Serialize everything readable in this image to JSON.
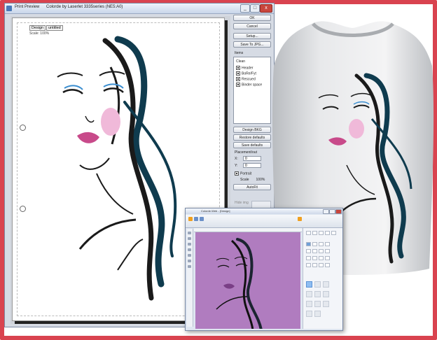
{
  "window": {
    "title": "Print Preview",
    "doc_title": "Colorde by Laserlet 3335series (NE5:A0)",
    "controls": {
      "minimize": "_",
      "maximize": "□",
      "close": "x"
    }
  },
  "paper": {
    "chips": [
      "Design",
      "untitled"
    ],
    "scale_text": "Scale: 100%"
  },
  "panel": {
    "ok": "OK",
    "cancel": "Cancel",
    "setup": "Setup...",
    "save_jpg": "Save To JPG...",
    "items_label": "Items",
    "items": [
      {
        "label": "Clean",
        "checked": null
      },
      {
        "label": "Header",
        "checked": true
      },
      {
        "label": "BoRe/Fyt",
        "checked": true
      },
      {
        "label": "Rescued",
        "checked": true
      },
      {
        "label": "Binder space",
        "checked": true
      }
    ],
    "design_bkg": "Design BKG",
    "restore_defaults": "Restore defaults",
    "save_defaults": "Save defaults",
    "placement_label": "Placement/out",
    "x_label": "X:",
    "x_value": "0",
    "y_label": "Y:",
    "y_value": "0",
    "portrait": "Portrait",
    "scale_label": "Scale",
    "scale_value": "100%",
    "autofit": "AutoFit",
    "bottom_label": "Hide img"
  },
  "editor": {
    "title": "Colorde.Web - [Design]"
  },
  "colors": {
    "frame": "#d9434f",
    "hair": "#0f3b4e",
    "lips": "#c84a8a",
    "blush": "#f0b9d9",
    "editor_canvas": "#b07cbf"
  },
  "icons": [
    "app-icon",
    "checkbox-icon",
    "spin-arrow-icon",
    "tool-icon"
  ]
}
